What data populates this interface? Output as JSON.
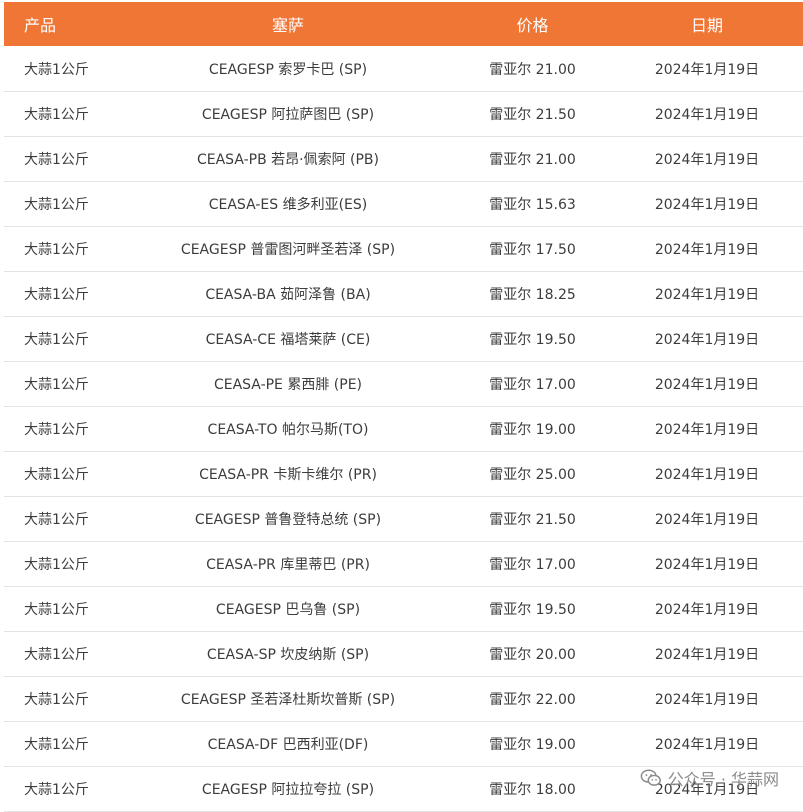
{
  "table": {
    "headers": [
      "产品",
      "塞萨",
      "价格",
      "日期"
    ],
    "rows": [
      [
        "大蒜1公斤",
        "CEAGESP 索罗卡巴 (SP)",
        "雷亚尔 21.00",
        "2024年1月19日"
      ],
      [
        "大蒜1公斤",
        "CEAGESP 阿拉萨图巴 (SP)",
        "雷亚尔 21.50",
        "2024年1月19日"
      ],
      [
        "大蒜1公斤",
        "CEASA-PB 若昂·佩索阿 (PB)",
        "雷亚尔 21.00",
        "2024年1月19日"
      ],
      [
        "大蒜1公斤",
        "CEASA-ES 维多利亚(ES)",
        "雷亚尔 15.63",
        "2024年1月19日"
      ],
      [
        "大蒜1公斤",
        "CEAGESP 普雷图河畔圣若泽 (SP)",
        "雷亚尔 17.50",
        "2024年1月19日"
      ],
      [
        "大蒜1公斤",
        "CEASA-BA 茹阿泽鲁 (BA)",
        "雷亚尔 18.25",
        "2024年1月19日"
      ],
      [
        "大蒜1公斤",
        "CEASA-CE 福塔莱萨 (CE)",
        "雷亚尔 19.50",
        "2024年1月19日"
      ],
      [
        "大蒜1公斤",
        "CEASA-PE 累西腓 (PE)",
        "雷亚尔 17.00",
        "2024年1月19日"
      ],
      [
        "大蒜1公斤",
        "CEASA-TO 帕尔马斯(TO)",
        "雷亚尔 19.00",
        "2024年1月19日"
      ],
      [
        "大蒜1公斤",
        "CEASA-PR 卡斯卡维尔 (PR)",
        "雷亚尔 25.00",
        "2024年1月19日"
      ],
      [
        "大蒜1公斤",
        "CEAGESP 普鲁登特总统 (SP)",
        "雷亚尔 21.50",
        "2024年1月19日"
      ],
      [
        "大蒜1公斤",
        "CEASA-PR 库里蒂巴 (PR)",
        "雷亚尔 17.00",
        "2024年1月19日"
      ],
      [
        "大蒜1公斤",
        "CEAGESP 巴乌鲁 (SP)",
        "雷亚尔 19.50",
        "2024年1月19日"
      ],
      [
        "大蒜1公斤",
        "CEASA-SP 坎皮纳斯 (SP)",
        "雷亚尔 20.00",
        "2024年1月19日"
      ],
      [
        "大蒜1公斤",
        "CEAGESP 圣若泽杜斯坎普斯 (SP)",
        "雷亚尔 22.00",
        "2024年1月19日"
      ],
      [
        "大蒜1公斤",
        "CEASA-DF 巴西利亚(DF)",
        "雷亚尔 19.00",
        "2024年1月19日"
      ],
      [
        "大蒜1公斤",
        "CEAGESP 阿拉拉夸拉 (SP)",
        "雷亚尔 18.00",
        "2024年1月19日"
      ]
    ]
  },
  "watermark": {
    "text": "公众号 · 华蒜网",
    "icon": "wechat-icon"
  },
  "colors": {
    "header_bg": "#f07636",
    "header_text": "#ffffff",
    "row_border": "#e4e4e4"
  }
}
